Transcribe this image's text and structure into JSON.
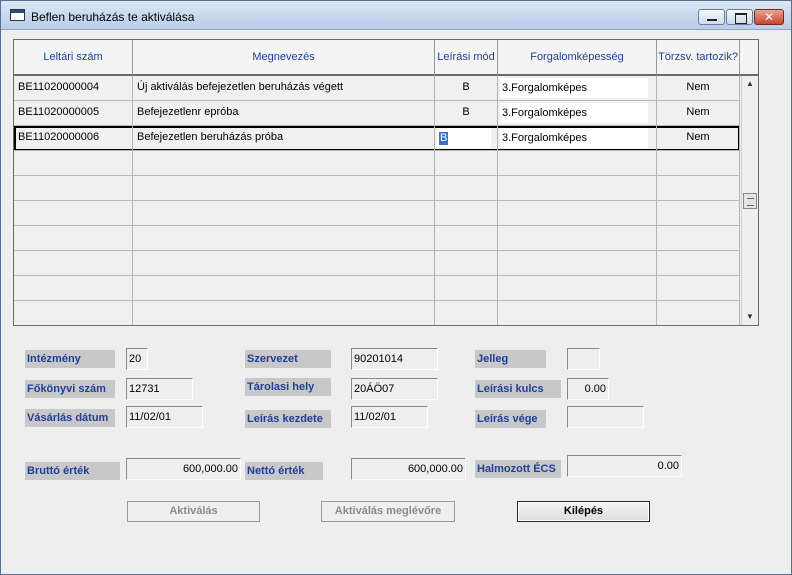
{
  "window": {
    "title": "Beflen beruházás te aktiválása"
  },
  "grid": {
    "columns": [
      "Leltári szám",
      "Megnevezés",
      "Leírási mód",
      "Forgalomképesség",
      "Törzsv. tartozik?"
    ],
    "rows": [
      {
        "leltari": "BE11020000004",
        "megnevezes": "Új aktiválás befejezetlen beruházás végett",
        "mod": "B",
        "forgalom": "3.Forgalomképes",
        "torzs": "Nem"
      },
      {
        "leltari": "BE11020000005",
        "megnevezes": "Befejezetlenr epróba",
        "mod": "B",
        "forgalom": "3.Forgalomképes",
        "torzs": "Nem"
      },
      {
        "leltari": "BE11020000006",
        "megnevezes": "Befejezetlen beruházás próba",
        "mod": "B",
        "forgalom": "3.Forgalomképes",
        "torzs": "Nem"
      }
    ]
  },
  "form": {
    "intezmeny_label": "Intézmény",
    "intezmeny": "20",
    "szervezet_label": "Szervezet",
    "szervezet": "90201014",
    "jelleg_label": "Jelleg",
    "jelleg": "",
    "fokonyvi_label": "Főkönyvi szám",
    "fokonyvi": "12731",
    "tarolasi_label": "Tárolasi hely",
    "tarolasi": "20ÁÖ07",
    "leirasi_kulcs_label": "Leírási kulcs",
    "leirasi_kulcs": "0.00",
    "vasarlas_label": "Vásárlás dátum",
    "vasarlas": "11/02/01",
    "leiras_kezdete_label": "Leírás kezdete",
    "leiras_kezdete": "11/02/01",
    "leiras_vege_label": "Leírás vége",
    "leiras_vege": "",
    "brutto_label": "Bruttó érték",
    "brutto": "600,000.00",
    "netto_label": "Nettó érték",
    "netto": "600,000.00",
    "halmozott_label": "Halmozott ÉCS",
    "halmozott": "0.00"
  },
  "buttons": {
    "aktivalas": "Aktiválás",
    "aktivalas_meglevore": "Aktiválás meglévőre",
    "kilepes": "Kilépés"
  }
}
